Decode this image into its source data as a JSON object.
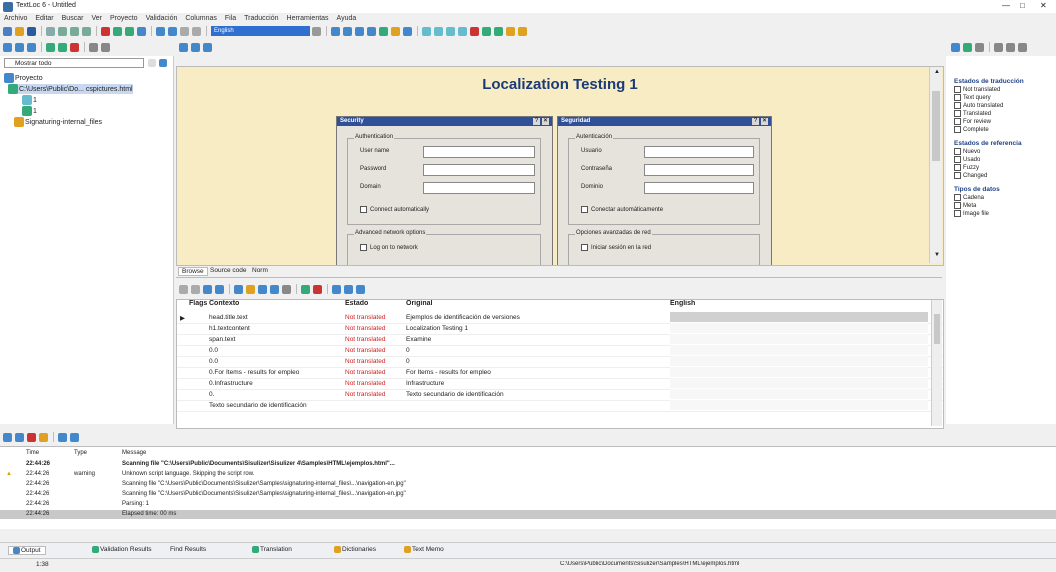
{
  "app": {
    "title": "TextLoc 6 - Untitled"
  },
  "window_controls": {
    "minimize": "—",
    "maximize": "□",
    "close": "✕"
  },
  "menu": [
    "Archivo",
    "Editar",
    "Buscar",
    "Ver",
    "Proyecto",
    "Validación",
    "Columnas",
    "Fila",
    "Traducción",
    "Herramientas",
    "Ayuda"
  ],
  "toolbar": {
    "language_select": "English"
  },
  "left_panel": {
    "filter": "Mostrar todo",
    "tree": [
      "Proyecto",
      "C:\\Users\\Public\\Do... cspictures.html",
      "1",
      "1",
      "Signaturing-internal_files"
    ]
  },
  "preview": {
    "title": "Localization Testing 1",
    "dialog1": {
      "title": "Security",
      "group1": "Authentication",
      "fields": [
        "User name",
        "Password",
        "Domain"
      ],
      "check1": "Connect automatically",
      "group2": "Advanced network options",
      "check2": "Log on to network"
    },
    "dialog2": {
      "title": "Seguridad",
      "group1": "Autenticación",
      "fields": [
        "Usuario",
        "Contraseña",
        "Dominio"
      ],
      "check1": "Conectar automáticamente",
      "group2": "Opciones avanzadas de red",
      "check2": "Iniciar sesión en la red"
    }
  },
  "tabs": [
    "Browse",
    "Source code",
    "Norm"
  ],
  "grid": {
    "headers": {
      "flags": "Flags",
      "context": "Contexto",
      "estado": "Estado",
      "original": "Original",
      "english": "English"
    },
    "rows": [
      {
        "context": "head.title.text",
        "estado": "Not translated",
        "original": "Ejemplos de identificación de versiones",
        "english": ""
      },
      {
        "context": "h1.textcontent",
        "estado": "Not translated",
        "original": "Localization Testing 1",
        "english": ""
      },
      {
        "context": "span.text",
        "estado": "Not translated",
        "original": "Examine",
        "english": ""
      },
      {
        "context": "0.0",
        "estado": "Not translated",
        "original": "0",
        "english": ""
      },
      {
        "context": "0.0",
        "estado": "Not translated",
        "original": "0",
        "english": ""
      },
      {
        "context": "0.For Items - results for empleo",
        "estado": "Not translated",
        "original": "For Items - results for empleo",
        "english": ""
      },
      {
        "context": "0.Infrastructure",
        "estado": "Not translated",
        "original": "Infrastructure",
        "english": ""
      },
      {
        "context": "0.",
        "estado": "Not translated",
        "original": "Texto secundario de identificación",
        "english": ""
      },
      {
        "context": "Texto secundario de identificación",
        "estado": "",
        "original": "",
        "english": ""
      }
    ]
  },
  "right_panel": {
    "section1": {
      "title": "Estados de traducción",
      "items": [
        "Not translated",
        "Text query",
        "Auto translated",
        "Translated",
        "For review",
        "Complete"
      ]
    },
    "section2": {
      "title": "Estados de referencia",
      "items": [
        "Nuevo",
        "Usado",
        "Fuzzy",
        "Changed"
      ]
    },
    "section3": {
      "title": "Tipos de datos",
      "items": [
        "Cadena",
        "Meta",
        "Image file"
      ]
    }
  },
  "log": {
    "headers": {
      "time": "Time",
      "type": "Type",
      "message": "Message"
    },
    "rows": [
      {
        "time": "22:44:26",
        "type": "",
        "message": "Scanning file \"C:\\Users\\Public\\Documents\\Sisulizer\\Sisulizer 4\\Samples\\HTML\\ejemplos.html\"...",
        "bold": true,
        "warn": false
      },
      {
        "time": "22:44:26",
        "type": "warning",
        "message": "Unknown script language. Skipping the script row.",
        "bold": false,
        "warn": true
      },
      {
        "time": "22:44:26",
        "type": "",
        "message": "Scanning file \"C:\\Users\\Public\\Documents\\Sisulizer\\Samples\\signaturing-internal_files\\...\\navigation-en.jpg\"",
        "bold": false,
        "warn": false
      },
      {
        "time": "22:44:26",
        "type": "",
        "message": "Scanning file \"C:\\Users\\Public\\Documents\\Sisulizer\\Samples\\signaturing-internal_files\\...\\navigation-en.jpg\"",
        "bold": false,
        "warn": false
      },
      {
        "time": "22:44:26",
        "type": "",
        "message": "Parsing: 1",
        "bold": false,
        "warn": false
      },
      {
        "time": "22:44:26",
        "type": "",
        "message": "Elapsed time: 00 ms",
        "bold": false,
        "warn": false
      }
    ]
  },
  "bottom_tabs": [
    "Output",
    "Validation Results",
    "Find Results",
    "Translation",
    "Dictionaries",
    "Text Memo"
  ],
  "status": {
    "left": "1:38",
    "path": "C:\\Users\\Public\\Documents\\Sisulizer\\Samples\\HTML\\ejemplos.html"
  },
  "colors": {
    "accent": "#2f4f98",
    "preview_bg": "#f7ecc4",
    "not_translated": "#d02020"
  }
}
